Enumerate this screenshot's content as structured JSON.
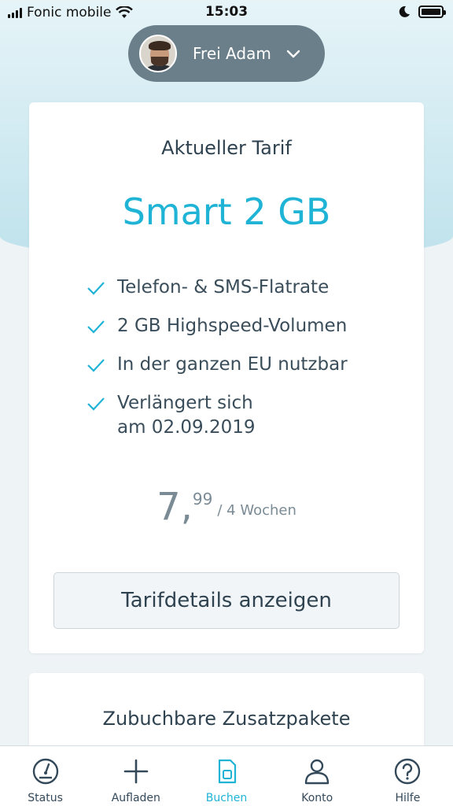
{
  "status_bar": {
    "carrier": "Fonic mobile",
    "time": "15:03"
  },
  "user": {
    "name": "Frei Adam"
  },
  "current_tariff": {
    "heading": "Aktueller Tarif",
    "name": "Smart 2 GB",
    "features": [
      "Telefon- & SMS-Flatrate",
      "2 GB Highspeed-Volumen",
      "In der ganzen EU nutzbar",
      "Verlängert sich\nam 02.09.2019"
    ],
    "price_euro": "7,",
    "price_cent": "99",
    "price_period": "/ 4 Wochen",
    "details_button": "Tarifdetails anzeigen"
  },
  "addons": {
    "heading": "Zubuchbare Zusatzpakete"
  },
  "tabbar": {
    "items": [
      {
        "label": "Status",
        "icon": "gauge-icon"
      },
      {
        "label": "Aufladen",
        "icon": "plus-icon"
      },
      {
        "label": "Buchen",
        "icon": "sim-card-icon"
      },
      {
        "label": "Konto",
        "icon": "person-icon"
      },
      {
        "label": "Hilfe",
        "icon": "question-icon"
      }
    ],
    "active": "Buchen"
  },
  "colors": {
    "accent": "#1fb3d6",
    "text_dark": "#2f4250",
    "pill_bg": "#6b7f8a"
  }
}
